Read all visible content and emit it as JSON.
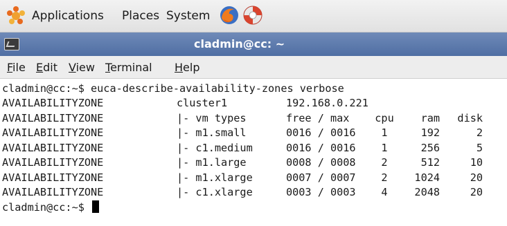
{
  "panel": {
    "applications_label": "Applications",
    "places_label": "Places",
    "system_label": "System",
    "icons": [
      "applications-icon",
      "firefox-icon",
      "help-lifebuoy-icon"
    ]
  },
  "window": {
    "title": "cladmin@cc: ~",
    "title_bar_color": "#5a77ab"
  },
  "menu": {
    "file": {
      "u": "F",
      "rest": "ile"
    },
    "edit": {
      "u": "E",
      "rest": "dit"
    },
    "view": {
      "u": "V",
      "rest": "iew"
    },
    "terminal": {
      "u": "T",
      "rest": "erminal"
    },
    "help": {
      "u": "H",
      "rest": "elp"
    }
  },
  "terminal": {
    "command_line": "cladmin@cc:~$ euca-describe-availability-zones verbose",
    "rows": [
      {
        "az": "AVAILABILITYZONE",
        "name": "cluster1",
        "free_max": "192.168.0.221",
        "cpu": "",
        "ram": "",
        "disk": ""
      },
      {
        "az": "AVAILABILITYZONE",
        "name": "|- vm types",
        "free_max": "free / max",
        "cpu": "cpu",
        "ram": "ram",
        "disk": "disk"
      },
      {
        "az": "AVAILABILITYZONE",
        "name": "|- m1.small",
        "free_max": "0016 / 0016",
        "cpu": "1",
        "ram": "192",
        "disk": "2"
      },
      {
        "az": "AVAILABILITYZONE",
        "name": "|- c1.medium",
        "free_max": "0016 / 0016",
        "cpu": "1",
        "ram": "256",
        "disk": "5"
      },
      {
        "az": "AVAILABILITYZONE",
        "name": "|- m1.large",
        "free_max": "0008 / 0008",
        "cpu": "2",
        "ram": "512",
        "disk": "10"
      },
      {
        "az": "AVAILABILITYZONE",
        "name": "|- m1.xlarge",
        "free_max": "0007 / 0007",
        "cpu": "2",
        "ram": "1024",
        "disk": "20"
      },
      {
        "az": "AVAILABILITYZONE",
        "name": "|- c1.xlarge",
        "free_max": "0003 / 0003",
        "cpu": "4",
        "ram": "2048",
        "disk": "20"
      }
    ],
    "prompt": "cladmin@cc:~$ "
  }
}
